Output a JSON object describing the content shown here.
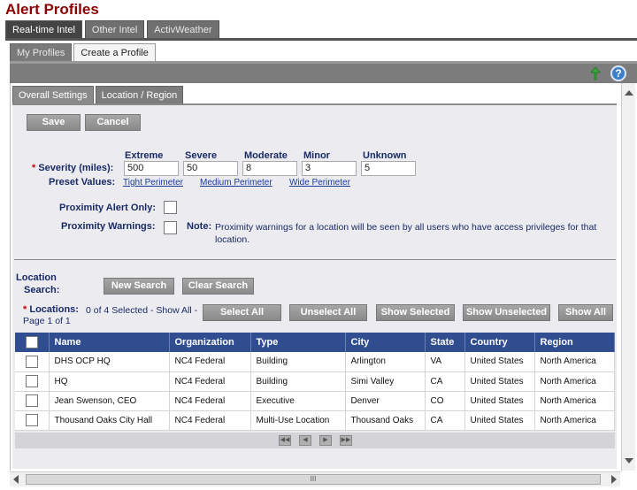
{
  "page_title": "Alert Profiles",
  "top_tabs": [
    "Real-time Intel",
    "Other Intel",
    "ActivWeather"
  ],
  "sub_tabs": [
    "My Profiles",
    "Create a Profile"
  ],
  "inner_tabs": [
    "Overall Settings",
    "Location / Region"
  ],
  "buttons": {
    "save": "Save",
    "cancel": "Cancel"
  },
  "severity": {
    "label": "Severity (miles):",
    "columns": [
      "Extreme",
      "Severe",
      "Moderate",
      "Minor",
      "Unknown"
    ],
    "values": [
      "500",
      "50",
      "8",
      "3",
      "5"
    ],
    "preset_label": "Preset Values:",
    "presets": [
      "Tight Perimeter",
      "Medium Perimeter",
      "Wide Perimeter"
    ]
  },
  "proximity": {
    "alert_only_label": "Proximity Alert Only:",
    "warnings_label": "Proximity Warnings:",
    "note_label": "Note:",
    "note_text": "Proximity warnings for a location will be seen by all users who have access privileges for that location."
  },
  "location_search": {
    "label_line1": "Location",
    "label_line2": "Search:",
    "new_search": "New Search",
    "clear_search": "Clear Search"
  },
  "locations": {
    "label": "Locations:",
    "selected_text": "0 of 4 Selected - Show All -",
    "page_text": "Page 1 of 1",
    "actions": [
      "Select All",
      "Unselect All",
      "Show Selected",
      "Show Unselected",
      "Show All"
    ]
  },
  "table": {
    "columns": [
      "Name",
      "Organization",
      "Type",
      "City",
      "State",
      "Country",
      "Region"
    ],
    "rows": [
      [
        "DHS OCP HQ",
        "NC4 Federal",
        "Building",
        "Arlington",
        "VA",
        "United States",
        "North America"
      ],
      [
        "HQ",
        "NC4 Federal",
        "Building",
        "Simi Valley",
        "CA",
        "United States",
        "North America"
      ],
      [
        "Jean Swenson, CEO",
        "NC4 Federal",
        "Executive",
        "Denver",
        "CO",
        "United States",
        "North America"
      ],
      [
        "Thousand Oaks City Hall",
        "NC4 Federal",
        "Multi-Use Location",
        "Thousand Oaks",
        "CA",
        "United States",
        "North America"
      ]
    ]
  },
  "scrollbar_grip": "III"
}
